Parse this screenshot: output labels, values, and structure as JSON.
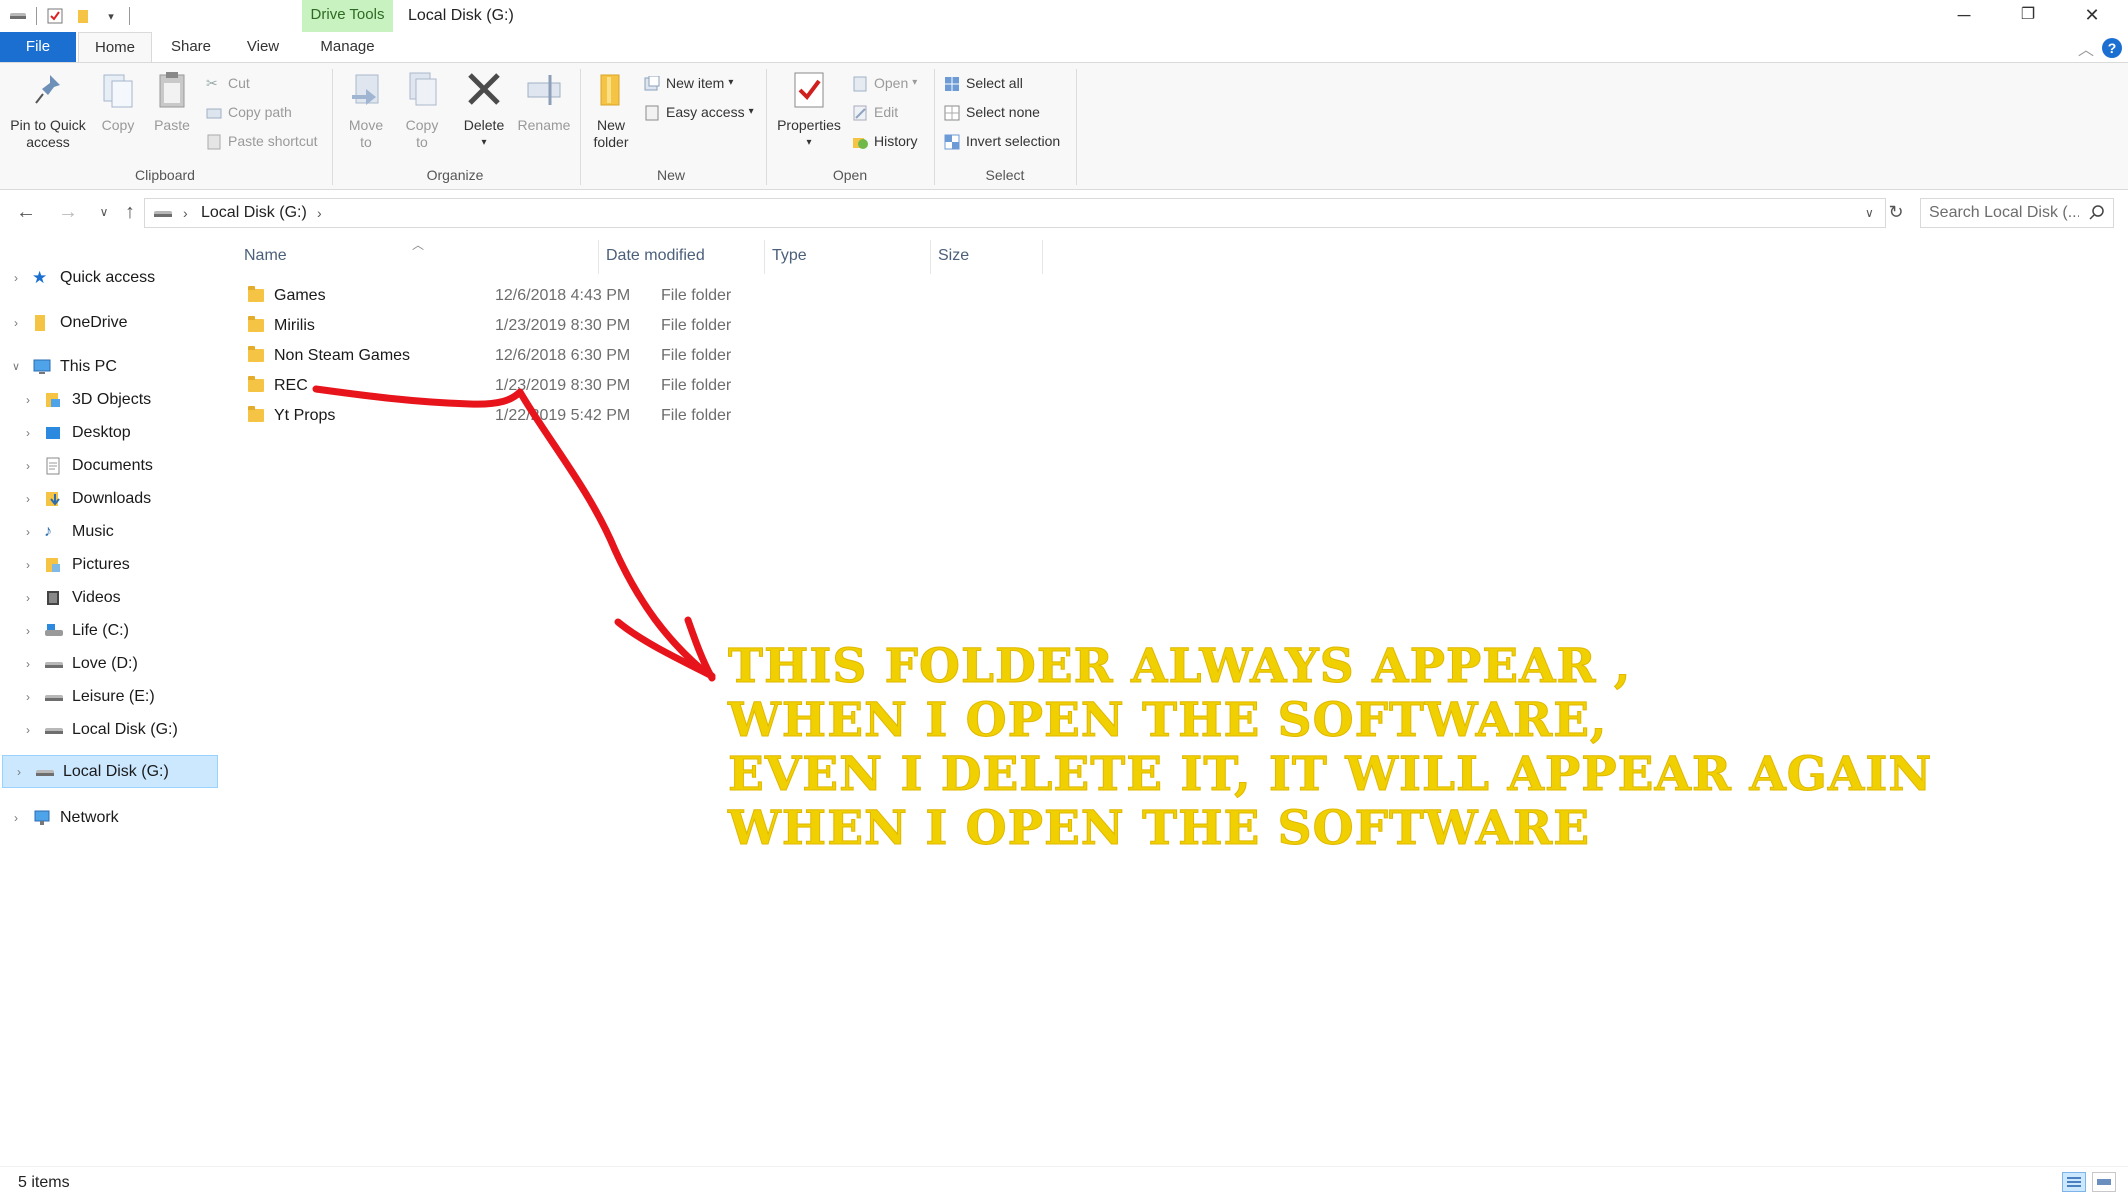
{
  "window": {
    "title": "Local Disk (G:)",
    "context_tab": "Drive Tools",
    "minimize": "─",
    "maximize": "❐",
    "close": "✕"
  },
  "ribbon_tabs": {
    "file": "File",
    "home": "Home",
    "share": "Share",
    "view": "View",
    "manage": "Manage"
  },
  "ribbon": {
    "clipboard": {
      "label": "Clipboard",
      "pin": "Pin to Quick",
      "pin2": "access",
      "copy": "Copy",
      "paste": "Paste",
      "cut": "Cut",
      "copy_path": "Copy path",
      "paste_shortcut": "Paste shortcut"
    },
    "organize": {
      "label": "Organize",
      "move_to": "Move",
      "move_to2": "to",
      "copy_to": "Copy",
      "copy_to2": "to",
      "delete": "Delete",
      "rename": "Rename"
    },
    "new": {
      "label": "New",
      "new_folder": "New",
      "new_folder2": "folder",
      "new_item": "New item",
      "easy_access": "Easy access"
    },
    "open": {
      "label": "Open",
      "properties": "Properties",
      "open": "Open",
      "edit": "Edit",
      "history": "History"
    },
    "select": {
      "label": "Select",
      "select_all": "Select all",
      "select_none": "Select none",
      "invert": "Invert selection"
    }
  },
  "address": {
    "crumb": "Local Disk (G:)",
    "search_placeholder": "Search Local Disk (..."
  },
  "nav": {
    "quick_access": "Quick access",
    "onedrive": "OneDrive",
    "this_pc": "This PC",
    "objects3d": "3D Objects",
    "desktop": "Desktop",
    "documents": "Documents",
    "downloads": "Downloads",
    "music": "Music",
    "pictures": "Pictures",
    "videos": "Videos",
    "life": "Life (C:)",
    "love": "Love (D:)",
    "leisure": "Leisure (E:)",
    "local_g_sub": "Local Disk (G:)",
    "local_g": "Local Disk (G:)",
    "network": "Network"
  },
  "columns": {
    "name": "Name",
    "date": "Date modified",
    "type": "Type",
    "size": "Size"
  },
  "files": [
    {
      "name": "Games",
      "date": "12/6/2018 4:43 PM",
      "type": "File folder"
    },
    {
      "name": "Mirilis",
      "date": "1/23/2019 8:30 PM",
      "type": "File folder"
    },
    {
      "name": "Non Steam Games",
      "date": "12/6/2018 6:30 PM",
      "type": "File folder"
    },
    {
      "name": "REC",
      "date": "1/23/2019 8:30 PM",
      "type": "File folder"
    },
    {
      "name": "Yt Props",
      "date": "1/22/2019 5:42 PM",
      "type": "File folder"
    }
  ],
  "annotation": {
    "line1": "THIS FOLDER ALWAYS APPEAR ,",
    "line2": "WHEN I OPEN THE SOFTWARE,",
    "line3": "EVEN I DELETE IT, IT WILL APPEAR AGAIN",
    "line4": "WHEN I OPEN THE SOFTWARE",
    "text_color": "#f0d000",
    "arrow_color": "#e8141c"
  },
  "status": {
    "items": "5 items"
  },
  "colors": {
    "file_tab": "#1a6fd1",
    "context_tab": "#c8f3c0",
    "selection": "#cce8ff"
  }
}
